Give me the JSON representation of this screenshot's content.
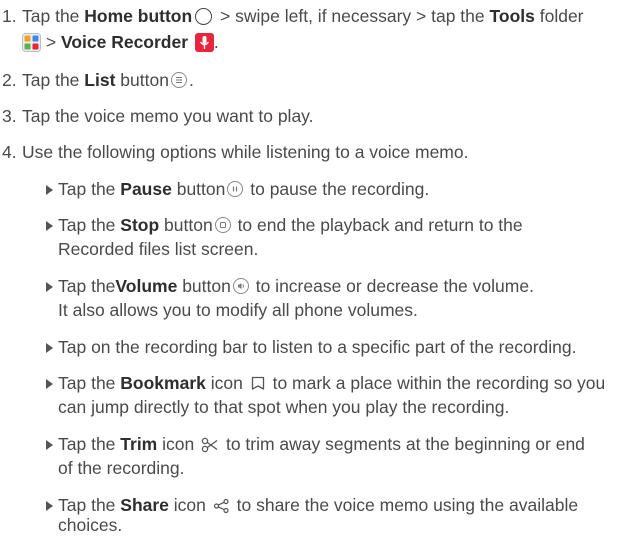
{
  "steps": [
    {
      "num": "1.",
      "line1": {
        "a": "Tap the ",
        "home": "Home button",
        "b": " > swipe left, if necessary > tap the ",
        "tools": "Tools",
        "c": " folder"
      },
      "line2": {
        "a": " > ",
        "recorder": "Voice Recorder"
      }
    },
    {
      "num": "2.",
      "a": "Tap the ",
      "list": "List",
      "b": " button",
      "c": "."
    },
    {
      "num": "3.",
      "text": "Tap the voice memo you want to play."
    },
    {
      "num": "4.",
      "text": "Use the following options while listening to a voice memo."
    }
  ],
  "options": [
    {
      "a": "Tap the ",
      "bold": "Pause",
      "b": " button",
      "c": " to pause the recording."
    },
    {
      "a": "Tap the ",
      "bold": "Stop",
      "b": " button",
      "c": " to end the playback and return to the",
      "line2": "Recorded files list screen."
    },
    {
      "a": "Tap the",
      "bold": "Volume",
      "b": " button",
      "c": " to increase or decrease the volume.",
      "line2": "It also allows you to modify all phone volumes."
    },
    {
      "text": "Tap on the recording bar to listen to a specific part of the recording."
    },
    {
      "a": "Tap the ",
      "bold": "Bookmark",
      "b": " icon",
      "c": " to mark a place within the recording so you",
      "line2": "can jump directly to that spot when you play the recording."
    },
    {
      "a": "Tap the ",
      "bold": "Trim",
      "b": " icon",
      "c": " to trim away segments at the beginning or end",
      "line2": "of the recording."
    },
    {
      "a": "Tap the ",
      "bold": "Share",
      "b": " icon",
      "c": " to share the voice memo using the available",
      "line2": "choices."
    }
  ],
  "icons": {
    "home": "home-circle-icon",
    "tools": "tools-folder-icon",
    "recorder": "voice-recorder-mic-icon",
    "list": "list-icon",
    "pause": "pause-icon",
    "stop": "stop-icon",
    "volume": "volume-icon",
    "bookmark": "bookmark-icon",
    "trim": "scissors-icon",
    "share": "share-icon",
    "accent": "#e8253b"
  }
}
